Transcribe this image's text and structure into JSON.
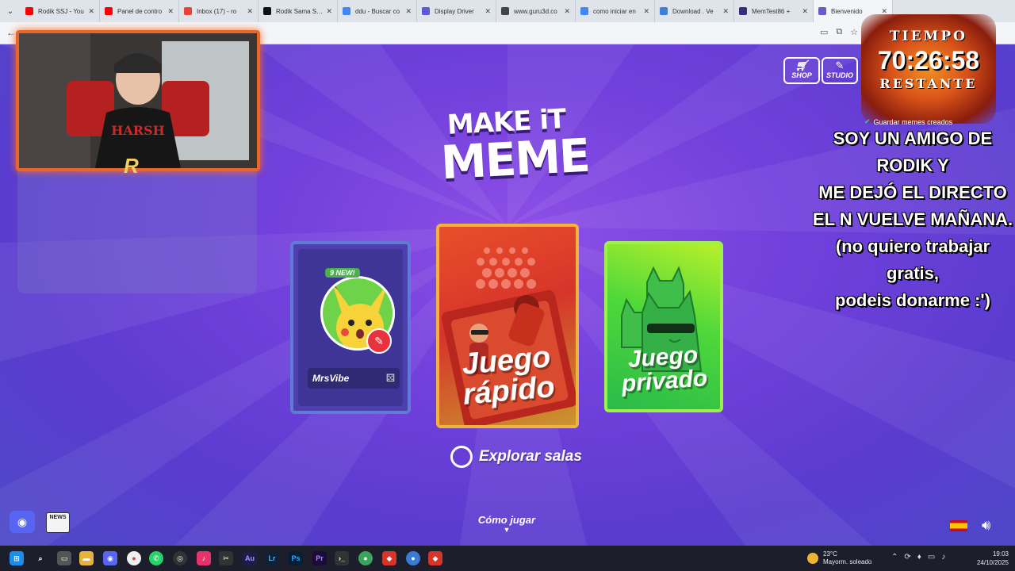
{
  "browser": {
    "tabs": [
      {
        "label": "Rodik SSJ - You",
        "color": "#ff0000"
      },
      {
        "label": "Panel de contro",
        "color": "#ff0000"
      },
      {
        "label": "Inbox (17) - ro",
        "color": "#ea4335"
      },
      {
        "label": "Rodik Sama SSJ",
        "color": "#111111"
      },
      {
        "label": "ddu - Buscar co",
        "color": "#4285f4"
      },
      {
        "label": "Display Driver",
        "color": "#5b5bd6"
      },
      {
        "label": "www.guru3d.co",
        "color": "#444444"
      },
      {
        "label": "como iniciar en",
        "color": "#4285f4"
      },
      {
        "label": "Download . Ve",
        "color": "#3b7fd6"
      },
      {
        "label": "MemTest86 +",
        "color": "#3a2d7a"
      },
      {
        "label": "Bienvenido",
        "color": "#6a5acd"
      }
    ],
    "close_glyph": "✕",
    "menu_glyph": "⌄"
  },
  "game": {
    "logo_line1": "MAKE iT",
    "logo_line2": "MEME",
    "shop_label": "SHOP",
    "studio_label": "STUDIO",
    "profile": {
      "new_badge": "9 NEW!",
      "username": "MrsVibe"
    },
    "quick_play": {
      "line1": "Juego",
      "line2": "rápido"
    },
    "private_play": {
      "line1": "Juego",
      "line2": "privado"
    },
    "explore_label": "Explorar salas",
    "how_to_play": "Cómo jugar",
    "news_label": "NEWS"
  },
  "stream": {
    "timer_top": "TIEMPO",
    "timer_value": "70:26:58",
    "timer_bottom": "RESTANTE",
    "goal_text": "Guardar memes creados",
    "message_lines": [
      "SOY UN AMIGO DE RODIK Y",
      "ME DEJÓ EL DIRECTO",
      "EL N VUELVE MAÑANA.",
      "(no quiero trabajar gratis,",
      "podeis donarme :')"
    ]
  },
  "taskbar": {
    "temperature": "23°C",
    "weather_desc": "Mayorm. soleado",
    "time": "19:03",
    "date": "24/10/2025",
    "apps": [
      "Au",
      "Lr",
      "Ps",
      "Pr"
    ]
  },
  "colors": {
    "accent_red": "#e8323f",
    "quick_card": "#d7342a",
    "private_card": "#4fd83a",
    "timer_orange": "#f29020"
  }
}
